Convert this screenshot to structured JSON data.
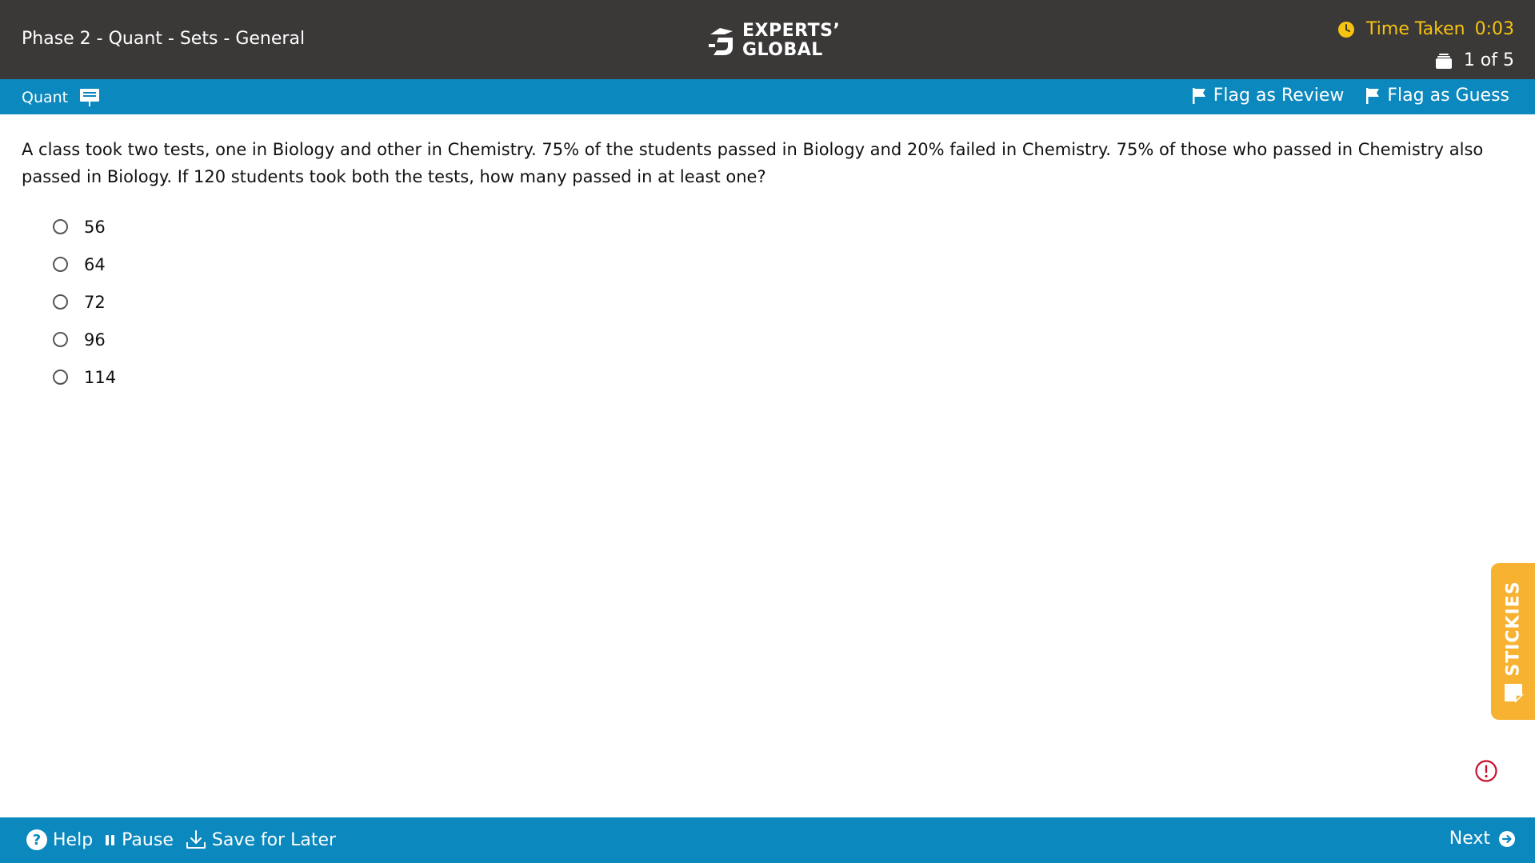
{
  "header": {
    "title": "Phase 2 - Quant - Sets - General",
    "logo_line1": "EXPERTS’",
    "logo_line2": "GLOBAL",
    "timer_label": "Time Taken",
    "timer_value": "0:03",
    "counter": "1 of 5"
  },
  "subbar": {
    "section": "Quant",
    "flag_review": "Flag as Review",
    "flag_guess": "Flag as Guess"
  },
  "question": {
    "text": "A class took two tests, one in Biology and other in Chemistry. 75% of the students passed in Biology and 20% failed in Chemistry. 75% of those who passed in Chemistry also passed in Biology. If 120 students took both the tests, how many passed in at least one?",
    "options": [
      "56",
      "64",
      "72",
      "96",
      "114"
    ]
  },
  "stickies": {
    "label": "STICKIES"
  },
  "footer": {
    "help": "Help",
    "pause": "Pause",
    "save": "Save for Later",
    "next": "Next"
  },
  "colors": {
    "header_bg": "#3b3838",
    "bar_blue": "#0b88bd",
    "timer_yellow": "#f6c30f",
    "stickies_orange": "#f6b230",
    "alert_red": "#c8102e"
  },
  "icons": [
    "logo-icon",
    "clock-icon",
    "question-stack-icon",
    "whiteboard-icon",
    "flag-icon",
    "help-icon",
    "pause-icon",
    "download-icon",
    "arrow-right-circle-icon",
    "sticky-note-icon",
    "alert-icon"
  ]
}
